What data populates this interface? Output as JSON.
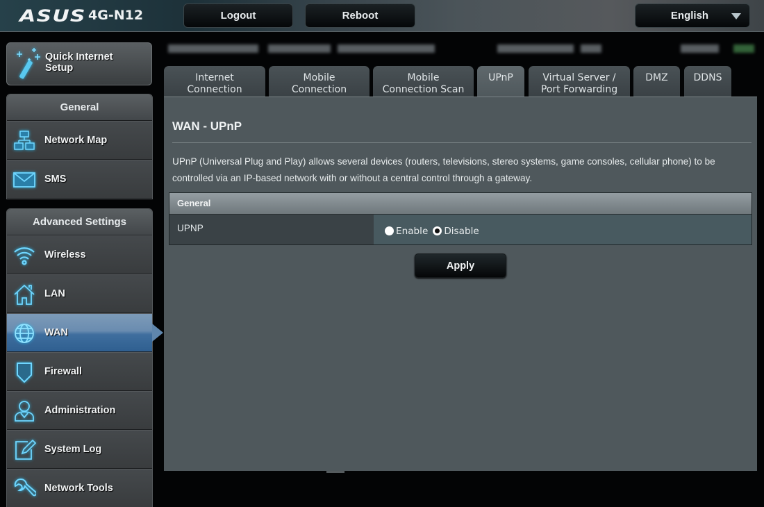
{
  "header": {
    "brand": "ASUS",
    "model": "4G-N12",
    "logout_label": "Logout",
    "reboot_label": "Reboot",
    "language": "English"
  },
  "sidebar": {
    "quick_setup": {
      "label_line1": "Quick Internet",
      "label_line2": "Setup",
      "icon": "magic-wand-icon"
    },
    "general": {
      "title": "General",
      "items": [
        {
          "label": "Network Map",
          "icon": "network-map-icon"
        },
        {
          "label": "SMS",
          "icon": "envelope-icon"
        }
      ]
    },
    "advanced": {
      "title": "Advanced Settings",
      "items": [
        {
          "label": "Wireless",
          "icon": "wifi-icon"
        },
        {
          "label": "LAN",
          "icon": "house-icon"
        },
        {
          "label": "WAN",
          "icon": "globe-icon",
          "active": true
        },
        {
          "label": "Firewall",
          "icon": "shield-icon"
        },
        {
          "label": "Administration",
          "icon": "user-icon"
        },
        {
          "label": "System Log",
          "icon": "edit-log-icon"
        },
        {
          "label": "Network Tools",
          "icon": "wrench-icon"
        }
      ]
    }
  },
  "tabs": [
    {
      "line1": "Internet",
      "line2": "Connection"
    },
    {
      "line1": "Mobile",
      "line2": "Connection"
    },
    {
      "line1": "Mobile",
      "line2": "Connection Scan"
    },
    {
      "line1": "UPnP",
      "line2": "",
      "active": true
    },
    {
      "line1": "Virtual Server /",
      "line2": "Port Forwarding"
    },
    {
      "line1": "DMZ",
      "line2": ""
    },
    {
      "line1": "DDNS",
      "line2": ""
    }
  ],
  "main": {
    "title": "WAN - UPnP",
    "description": "UPnP (Universal Plug and Play) allows several devices (routers, televisions, stereo systems, game consoles, cellular phone) to be controlled via an IP-based network with or without a central control through a gateway.",
    "section_title": "General",
    "setting_label": "UPNP",
    "options": [
      {
        "label": "Enable",
        "checked": false
      },
      {
        "label": "Disable",
        "checked": true
      }
    ],
    "apply_label": "Apply"
  },
  "colors": {
    "accent_icon": "#29b7e8",
    "active_menu": "#3f6e9e",
    "panel_bg": "#4f585c"
  }
}
